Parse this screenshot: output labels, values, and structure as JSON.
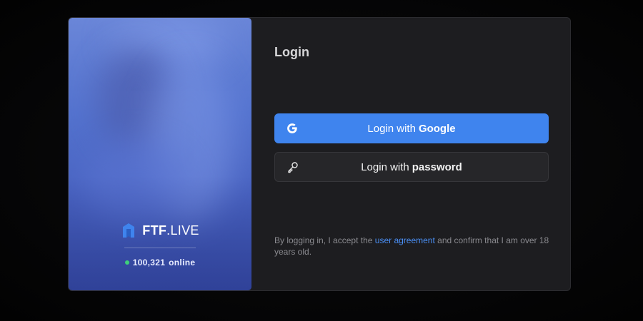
{
  "brand": {
    "name_bold": "FTF",
    "name_rest": ".LIVE",
    "online_count": "100,321",
    "online_suffix": "online",
    "online_color": "#3ed07a"
  },
  "login": {
    "title": "Login",
    "google_prefix": "Login with",
    "google_bold": "Google",
    "google_icon": "google-g-icon",
    "password_prefix": "Login with",
    "password_bold": "password",
    "password_icon": "key-icon"
  },
  "terms": {
    "before": "By logging in, I accept the",
    "link": "user agreement",
    "after": "and confirm that I am over 18 years old."
  },
  "colors": {
    "accent": "#3f84ee",
    "link": "#4a8ff5",
    "panel_bg": "#1d1d20"
  }
}
